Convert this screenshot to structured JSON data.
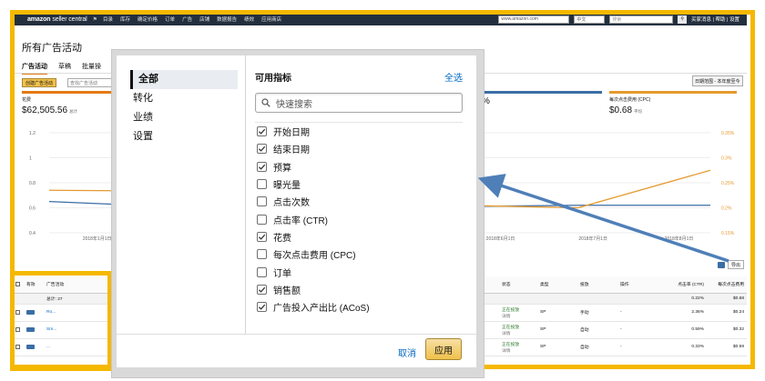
{
  "topbar": {
    "logo_bold": "amazon",
    "logo_light": " seller central",
    "nav": [
      "目录",
      "库存",
      "确定价格",
      "订单",
      "广告",
      "店铺",
      "数据报告",
      "绩效",
      "应用商店"
    ],
    "search_value": "www.amazon.com",
    "lang": "中文",
    "search_placeholder": "搜索",
    "links": "买家消息 | 帮助 | 设置"
  },
  "page": {
    "title": "所有广告活动",
    "tabs": [
      "广告活动",
      "草稿",
      "批量操"
    ],
    "create_button": "创建广告活动",
    "search_placeholder": "查找广告活动",
    "date_range": "日期范围 - 本年度至今",
    "metrics": [
      {
        "label": "花费",
        "value": "$62,505.56",
        "unit": "总计"
      },
      {
        "label": "",
        "value": "%",
        "unit": ""
      },
      {
        "label": "每次点击费用 (CPC)",
        "value": "$0.68",
        "unit": "平均"
      }
    ],
    "export": "导出"
  },
  "chart_data": {
    "type": "line",
    "x_ticks": [
      "2018年1月1日",
      "2018年6月1日",
      "2018年7月1日",
      "2018年8月1日"
    ],
    "y_left_ticks": [
      "1.2",
      "1",
      "0.8",
      "0.6",
      "0.4"
    ],
    "y_right_ticks": [
      "0.35%",
      "0.3%",
      "0.25%",
      "0.2%",
      "0.15%"
    ],
    "ylim_left": [
      0.4,
      1.2
    ],
    "ylim_right": [
      0.15,
      0.35
    ],
    "series": [
      {
        "color": "#3a6ea5",
        "axis": "left",
        "x": [
          0,
          0.27,
          0.62,
          0.8,
          1
        ],
        "y": [
          0.65,
          0.59,
          0.61,
          0.62,
          0.62
        ]
      },
      {
        "color": "#e59a2e",
        "axis": "left",
        "x": [
          0,
          0.27,
          0.62,
          0.8,
          1
        ],
        "y": [
          0.74,
          0.73,
          0.62,
          0.6,
          0.9
        ]
      }
    ]
  },
  "table": {
    "headers": [
      "",
      "有效",
      "广告活动",
      "状态",
      "类型",
      "投放",
      "操作",
      "点击率 (CTR)",
      "每次点击费用"
    ],
    "total_label": "总计: 27",
    "total_ctr": "0.22%",
    "total_cpc": "$0.68",
    "rows": [
      {
        "name": "Ro...",
        "status": "正在投放",
        "sub": "详情",
        "type": "SP",
        "target": "手动",
        "action": "-",
        "ctr": "2.36%",
        "cpc": "$0.24"
      },
      {
        "name": "Sm...",
        "status": "正在投放",
        "sub": "详情",
        "type": "SP",
        "target": "自动",
        "action": "-",
        "ctr": "0.59%",
        "cpc": "$0.32"
      },
      {
        "name": "...",
        "status": "正在投放",
        "sub": "详情",
        "type": "SP",
        "target": "自动",
        "action": "-",
        "ctr": "0.33%",
        "cpc": "$0.59"
      }
    ]
  },
  "modal": {
    "nav": [
      "全部",
      "转化",
      "业绩",
      "设置"
    ],
    "active_nav": 0,
    "title": "可用指标",
    "select_all": "全选",
    "search_placeholder": "快速搜索",
    "options": [
      {
        "label": "开始日期",
        "checked": true
      },
      {
        "label": "结束日期",
        "checked": true
      },
      {
        "label": "预算",
        "checked": true
      },
      {
        "label": "曝光量",
        "checked": false
      },
      {
        "label": "点击次数",
        "checked": false
      },
      {
        "label": "点击率 (CTR)",
        "checked": false
      },
      {
        "label": "花费",
        "checked": true
      },
      {
        "label": "每次点击费用 (CPC)",
        "checked": false
      },
      {
        "label": "订单",
        "checked": false
      },
      {
        "label": "销售额",
        "checked": true
      },
      {
        "label": "广告投入产出比 (ACoS)",
        "checked": true
      }
    ],
    "cancel": "取消",
    "apply": "应用"
  },
  "colors": {
    "highlight": "#f5b800",
    "accent": "#e47911",
    "arrow": "#4f7fb8",
    "link": "#0066c0"
  }
}
